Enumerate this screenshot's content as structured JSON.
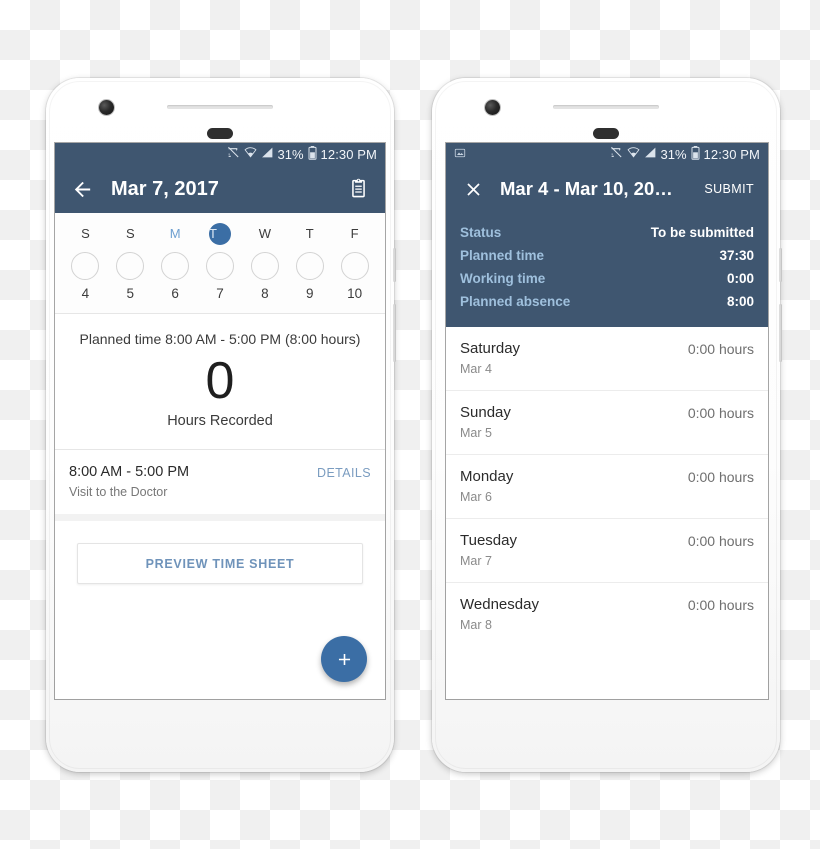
{
  "phone_left": {
    "status_bar": {
      "icons": [
        "cast-muted-icon",
        "wifi-icon",
        "signal-icon"
      ],
      "battery_percent": "31%",
      "battery_icon": "battery-icon",
      "time": "12:30 PM"
    },
    "app_bar": {
      "back_icon": "arrow-left-icon",
      "title": "Mar 7, 2017",
      "clipboard_icon": "clipboard-icon"
    },
    "week_strip": {
      "days": [
        {
          "dow": "S",
          "num": "4",
          "state": "normal"
        },
        {
          "dow": "S",
          "num": "5",
          "state": "normal"
        },
        {
          "dow": "M",
          "num": "6",
          "state": "muted"
        },
        {
          "dow": "T",
          "num": "7",
          "state": "selected"
        },
        {
          "dow": "W",
          "num": "8",
          "state": "normal"
        },
        {
          "dow": "T",
          "num": "9",
          "state": "normal"
        },
        {
          "dow": "F",
          "num": "10",
          "state": "normal"
        }
      ]
    },
    "summary": {
      "planned_time": "Planned time 8:00 AM - 5:00 PM (8:00 hours)",
      "hours_value": "0",
      "hours_caption": "Hours Recorded"
    },
    "entry": {
      "time_range": "8:00 AM - 5:00 PM",
      "description": "Visit to the Doctor",
      "details_label": "DETAILS"
    },
    "preview_button_label": "PREVIEW TIME SHEET",
    "fab": {
      "icon": "plus-icon"
    }
  },
  "phone_right": {
    "status_bar": {
      "notification_icon": "screenshot-icon",
      "icons": [
        "cast-muted-icon",
        "wifi-icon",
        "signal-icon"
      ],
      "battery_percent": "31%",
      "battery_icon": "battery-icon",
      "time": "12:30 PM"
    },
    "app_bar": {
      "close_icon": "close-icon",
      "title": "Mar 4 - Mar 10, 20…",
      "submit_label": "SUBMIT"
    },
    "summary_rows": [
      {
        "label": "Status",
        "value": "To be submitted"
      },
      {
        "label": "Planned time",
        "value": "37:30"
      },
      {
        "label": "Working time",
        "value": "0:00"
      },
      {
        "label": "Planned absence",
        "value": "8:00"
      }
    ],
    "days": [
      {
        "name": "Saturday",
        "date": "Mar 4",
        "hours": "0:00 hours"
      },
      {
        "name": "Sunday",
        "date": "Mar 5",
        "hours": "0:00 hours"
      },
      {
        "name": "Monday",
        "date": "Mar 6",
        "hours": "0:00 hours"
      },
      {
        "name": "Tuesday",
        "date": "Mar 7",
        "hours": "0:00 hours"
      },
      {
        "name": "Wednesday",
        "date": "Mar 8",
        "hours": "0:00 hours"
      }
    ]
  },
  "colors": {
    "header": "#3f5670",
    "accent": "#3b6ea5",
    "label_blue": "#9fc0dd",
    "link_blue": "#7a9cc0"
  }
}
